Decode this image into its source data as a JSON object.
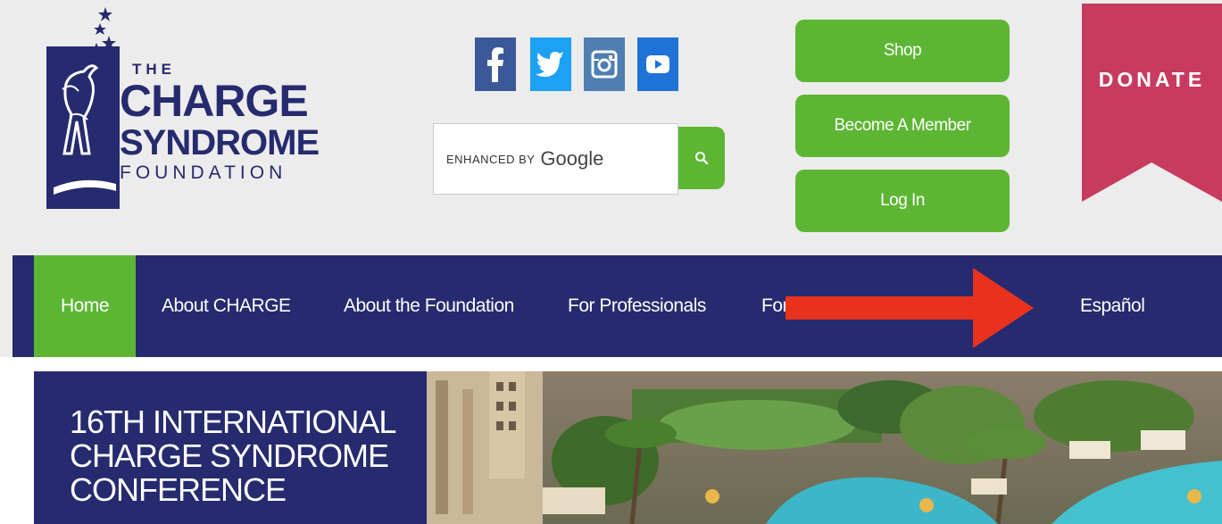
{
  "logo": {
    "line1": "THE",
    "line2": "CHARGE",
    "line3": "SYNDROME",
    "line4": "FOUNDATION"
  },
  "social": {
    "facebook_icon": "facebook-icon",
    "twitter_icon": "twitter-icon",
    "instagram_icon": "instagram-icon",
    "youtube_icon": "youtube-icon"
  },
  "search": {
    "enhanced_by": "ENHANCED BY",
    "google": "Google",
    "button_icon": "search-icon"
  },
  "header_buttons": {
    "shop": "Shop",
    "member": "Become A Member",
    "login": "Log In"
  },
  "donate": {
    "label": "DONATE"
  },
  "nav": {
    "items": [
      {
        "label": "Home"
      },
      {
        "label": "About CHARGE"
      },
      {
        "label": "About the Foundation"
      },
      {
        "label": "For Professionals"
      },
      {
        "label": "For Families"
      },
      {
        "label": "Español"
      }
    ]
  },
  "hero": {
    "line1": "16TH INTERNATIONAL",
    "line2": "CHARGE SYNDROME",
    "line3": "CONFERENCE"
  },
  "colors": {
    "navy": "#262a6e",
    "green": "#5db633",
    "donate": "#c73b5e",
    "annotation_arrow": "#e8321e"
  }
}
